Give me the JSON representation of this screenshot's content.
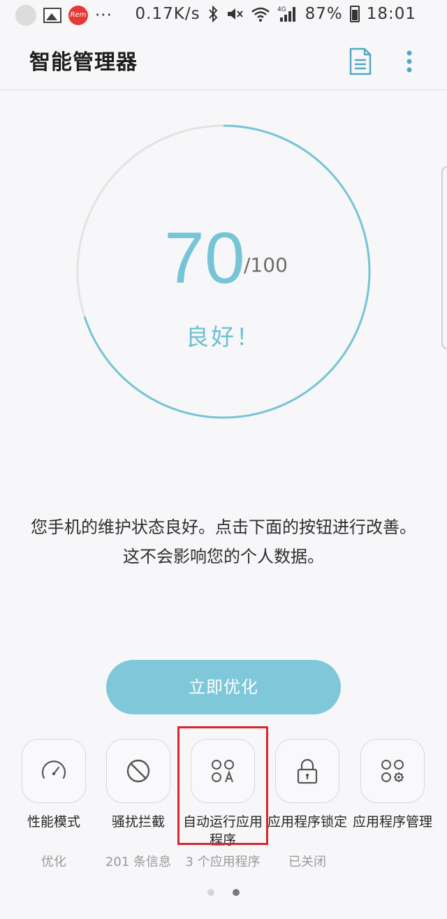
{
  "status_bar": {
    "network_speed": "0.17K/s",
    "network_type": "4G",
    "battery": "87%",
    "time": "18:01",
    "more": "···",
    "notification_icons": [
      "app-icon",
      "gallery-icon",
      "red-app-icon"
    ],
    "red_icon_label": "Rem",
    "system_icons": [
      "bluetooth-icon",
      "mute-icon",
      "wifi-icon",
      "signal-icon",
      "battery-icon"
    ]
  },
  "header": {
    "title": "智能管理器",
    "icons": [
      "report-icon",
      "more-options-icon"
    ]
  },
  "score": {
    "value": "70",
    "max": "/100",
    "fraction": 0.7,
    "status": "良好！",
    "accent_color": "#76c5d7"
  },
  "description": "您手机的维护状态良好。点击下面的按钮进行改善。这不会影响您的个人数据。",
  "optimize_button": {
    "label": "立即优化",
    "color": "#7ec8d9"
  },
  "features": [
    {
      "label": "性能模式",
      "sub": "优化",
      "icon": "speedometer-icon"
    },
    {
      "label": "骚扰拦截",
      "sub": "201 条信息",
      "icon": "block-icon"
    },
    {
      "label": "自动运行应用程序",
      "sub": "3 个应用程序",
      "icon": "auto-run-apps-icon",
      "highlighted": true
    },
    {
      "label": "应用程序锁定",
      "sub": "已关闭",
      "icon": "lock-icon"
    },
    {
      "label": "应用程序管理",
      "sub": "",
      "icon": "app-settings-icon"
    }
  ],
  "pagination": {
    "pages": 2,
    "current": 2
  }
}
